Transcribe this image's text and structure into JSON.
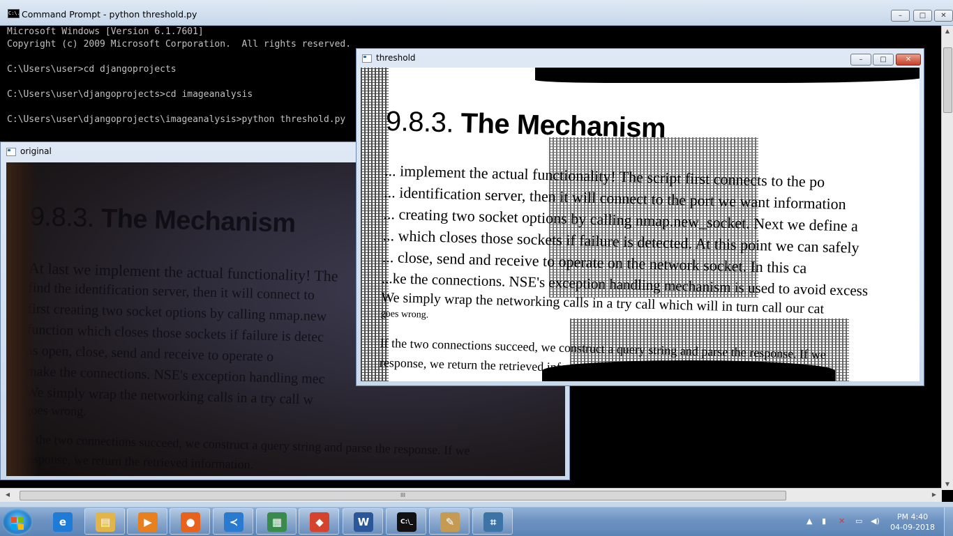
{
  "console": {
    "title": "Command Prompt - python  threshold.py",
    "icon_text": "C:\\.",
    "lines": "Microsoft Windows [Version 6.1.7601]\nCopyright (c) 2009 Microsoft Corporation.  All rights reserved.\n\nC:\\Users\\user>cd djangoprojects\n\nC:\\Users\\user\\djangoprojects>cd imageanalysis\n\nC:\\Users\\user\\djangoprojects\\imageanalysis>python threshold.py"
  },
  "window_controls": {
    "minimize": "–",
    "maximize": "□",
    "close": "✕"
  },
  "original_window": {
    "title": "original",
    "image": {
      "heading_num": "9.8.3.",
      "heading_text": " The Mechanism",
      "lines": [
        "At last we implement the actual functionality! The",
        "find the identification server, then it will connect to",
        "first creating two socket options by calling nmap.new",
        "function which closes those sockets if failure is detec",
        "as open, close, send and receive to operate o",
        "make the connections. NSE's exception handling mec",
        "We simply wrap the networking calls in a try call w",
        "goes wrong.",
        "If the two connections succeed, we construct a query string and parse the response. If we",
        "response, we return the retrieved information."
      ]
    }
  },
  "threshold_window": {
    "title": "threshold",
    "image": {
      "heading_num": "9.8.3.",
      "heading_text": " The Mechanism",
      "lines": [
        "... implement the actual functionality! The script first connects to the po",
        "... identification server, then it will connect to the port we want information",
        "... creating two socket options by calling nmap.new_socket. Next we define a",
        "... which closes those sockets if failure is detected. At this point we can safely",
        "... close, send and receive to operate on the network socket. In this ca",
        "...ke the connections. NSE's exception handling mechanism is used to avoid excess",
        "We simply wrap the networking calls in a try call which will in turn call our cat",
        "goes wrong.",
        "If the two connections succeed, we construct a query string and parse the response. If we",
        "response, we return the retrieved information."
      ]
    }
  },
  "scrollbar": {
    "grip": "III"
  },
  "taskbar": {
    "items": [
      {
        "name": "ie",
        "glyph": "e",
        "color": "#1e7bd6"
      },
      {
        "name": "explorer",
        "glyph": "▤",
        "color": "#e2b54a"
      },
      {
        "name": "media-player",
        "glyph": "▶",
        "color": "#e8801f"
      },
      {
        "name": "firefox",
        "glyph": "●",
        "color": "#e8621c"
      },
      {
        "name": "vscode",
        "glyph": "≺",
        "color": "#2a7bd0"
      },
      {
        "name": "notepad",
        "glyph": "▦",
        "color": "#3a8a4d"
      },
      {
        "name": "git",
        "glyph": "◆",
        "color": "#d6432c"
      },
      {
        "name": "word",
        "glyph": "W",
        "color": "#2b579a"
      },
      {
        "name": "cmd",
        "glyph": "C:\\_",
        "color": "#111111"
      },
      {
        "name": "paint",
        "glyph": "✎",
        "color": "#c59a52"
      },
      {
        "name": "python",
        "glyph": "⌗",
        "color": "#3d74a8"
      }
    ],
    "clock_time": "PM 4:40",
    "clock_date": "04-09-2018"
  },
  "colors": {
    "console_bg": "#000000",
    "console_text": "#c0c0c0",
    "title_bar": "#dfe9f5",
    "taskbar": "#6e93c2"
  }
}
